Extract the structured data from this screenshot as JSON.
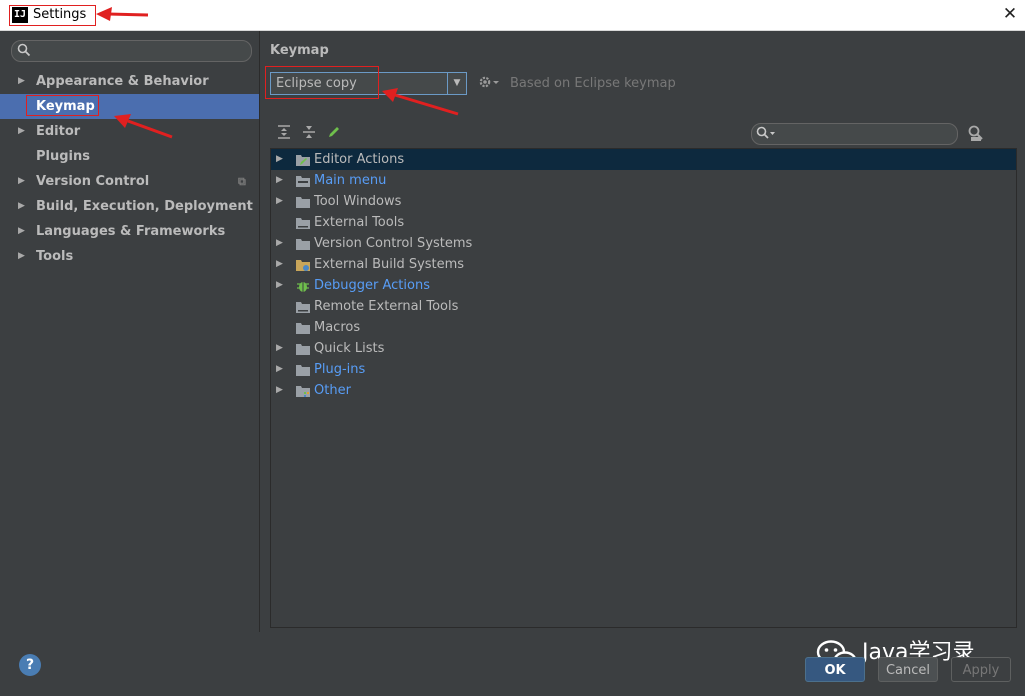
{
  "window": {
    "title": "Settings",
    "app_icon": "IJ"
  },
  "sidebar": {
    "search_placeholder": "",
    "items": [
      {
        "label": "Appearance & Behavior",
        "expandable": true
      },
      {
        "label": "Keymap",
        "expandable": false,
        "selected": true
      },
      {
        "label": "Editor",
        "expandable": true
      },
      {
        "label": "Plugins",
        "expandable": false
      },
      {
        "label": "Version Control",
        "expandable": true
      },
      {
        "label": "Build, Execution, Deployment",
        "expandable": true
      },
      {
        "label": "Languages & Frameworks",
        "expandable": true
      },
      {
        "label": "Tools",
        "expandable": true
      }
    ]
  },
  "main": {
    "title": "Keymap",
    "keymap_select": {
      "value": "Eclipse copy"
    },
    "based_on": "Based on Eclipse keymap",
    "toolbar": [
      "expand-all-icon",
      "collapse-all-icon",
      "edit-icon"
    ],
    "tree": [
      {
        "label": "Editor Actions",
        "selected": true,
        "blue": false
      },
      {
        "label": "Main menu",
        "selected": false,
        "blue": true
      },
      {
        "label": "Tool Windows",
        "selected": false,
        "blue": false
      },
      {
        "label": "External Tools",
        "selected": false,
        "blue": false
      },
      {
        "label": "Version Control Systems",
        "selected": false,
        "blue": false
      },
      {
        "label": "External Build Systems",
        "selected": false,
        "blue": false
      },
      {
        "label": "Debugger Actions",
        "selected": false,
        "blue": true
      },
      {
        "label": "Remote External Tools",
        "selected": false,
        "blue": false
      },
      {
        "label": "Macros",
        "selected": false,
        "blue": false
      },
      {
        "label": "Quick Lists",
        "selected": false,
        "blue": false
      },
      {
        "label": "Plug-ins",
        "selected": false,
        "blue": true
      },
      {
        "label": "Other",
        "selected": false,
        "blue": true
      }
    ]
  },
  "footer": {
    "help": "?",
    "ok": "OK",
    "cancel": "Cancel",
    "apply": "Apply",
    "watermark": "Java学习录"
  },
  "colors": {
    "background": "#3c3f41",
    "selection": "#4b6eaf",
    "tree_selection": "#0d293e",
    "link_blue": "#589df6",
    "annotation_red": "#e02020"
  }
}
